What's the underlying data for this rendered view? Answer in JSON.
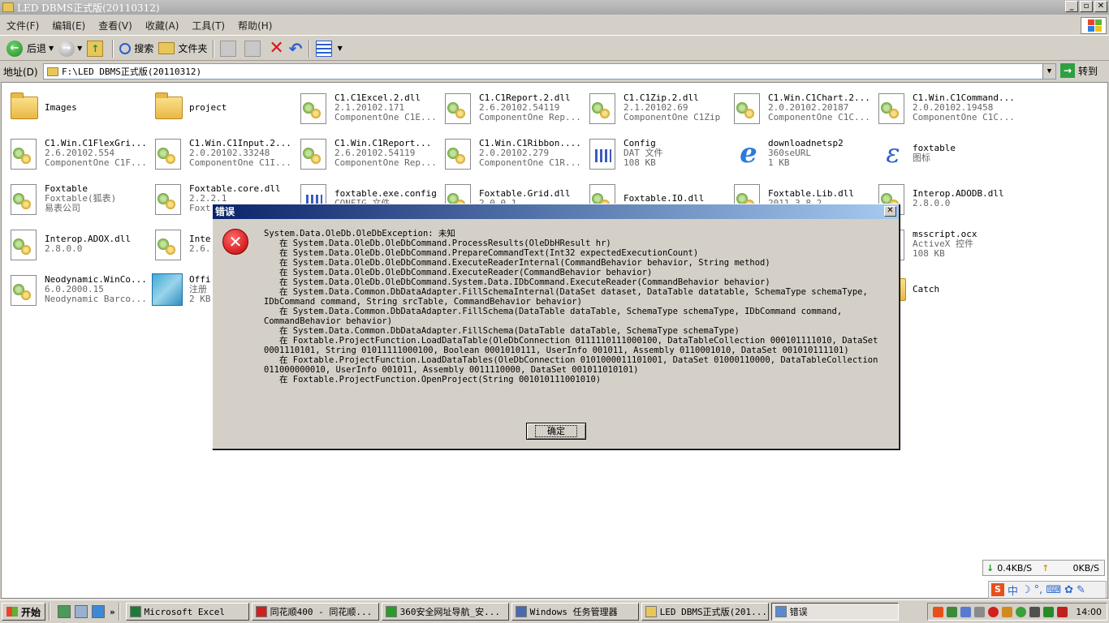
{
  "window": {
    "title": "LED DBMS正式版(20110312)"
  },
  "menu": [
    "文件(F)",
    "编辑(E)",
    "查看(V)",
    "收藏(A)",
    "工具(T)",
    "帮助(H)"
  ],
  "toolbar": {
    "back": "后退",
    "search": "搜索",
    "folders": "文件夹"
  },
  "address": {
    "label": "地址(D)",
    "value": "F:\\LED DBMS正式版(20110312)",
    "go": "转到"
  },
  "files": [
    {
      "name": "Images",
      "line2": "",
      "line3": "",
      "icon": "folder-icon"
    },
    {
      "name": "project",
      "line2": "",
      "line3": "",
      "icon": "folder-icon"
    },
    {
      "name": "C1.C1Excel.2.dll",
      "line2": "2.1.20102.171",
      "line3": "ComponentOne C1E...",
      "icon": "dll-icon"
    },
    {
      "name": "C1.C1Report.2.dll",
      "line2": "2.6.20102.54119",
      "line3": "ComponentOne Rep...",
      "icon": "dll-icon"
    },
    {
      "name": "C1.C1Zip.2.dll",
      "line2": "2.1.20102.69",
      "line3": "ComponentOne C1Zip",
      "icon": "dll-icon"
    },
    {
      "name": "C1.Win.C1Chart.2...",
      "line2": "2.0.20102.20187",
      "line3": "ComponentOne C1C...",
      "icon": "dll-icon"
    },
    {
      "name": "C1.Win.C1Command...",
      "line2": "2.0.20102.19458",
      "line3": "ComponentOne C1C...",
      "icon": "dll-icon"
    },
    {
      "name": "C1.Win.C1FlexGri...",
      "line2": "2.6.20102.554",
      "line3": "ComponentOne C1F...",
      "icon": "dll-icon"
    },
    {
      "name": "C1.Win.C1Input.2...",
      "line2": "2.0.20102.33248",
      "line3": "ComponentOne C1I...",
      "icon": "dll-icon"
    },
    {
      "name": "C1.Win.C1Report...",
      "line2": "2.6.20102.54119",
      "line3": "ComponentOne Rep...",
      "icon": "dll-icon"
    },
    {
      "name": "C1.Win.C1Ribbon....",
      "line2": "2.0.20102.279",
      "line3": "ComponentOne C1R...",
      "icon": "dll-icon"
    },
    {
      "name": "Config",
      "line2": "DAT 文件",
      "line3": "108 KB",
      "icon": "config-file-icon"
    },
    {
      "name": "downloadnetsp2",
      "line2": "360seURL",
      "line3": "1 KB",
      "icon": "ie-icon"
    },
    {
      "name": "foxtable",
      "line2": "图标",
      "line3": "",
      "icon": "foxtable-icon"
    },
    {
      "name": "Foxtable",
      "line2": "Foxtable(狐表)",
      "line3": "易表公司",
      "icon": "dll-icon"
    },
    {
      "name": "Foxtable.core.dll",
      "line2": "2.2.2.1",
      "line3": "Foxt",
      "icon": "dll-icon"
    },
    {
      "name": "foxtable.exe.config",
      "line2": "CONFIG 文件",
      "line3": "",
      "icon": "config-file-icon"
    },
    {
      "name": "Foxtable.Grid.dll",
      "line2": "2.0.0.1",
      "line3": "",
      "icon": "dll-icon"
    },
    {
      "name": "Foxtable.IO.dll",
      "line2": "",
      "line3": "",
      "icon": "dll-icon"
    },
    {
      "name": "Foxtable.Lib.dll",
      "line2": "2011.3.8.2",
      "line3": "",
      "icon": "dll-icon"
    },
    {
      "name": "Interop.ADODB.dll",
      "line2": "2.8.0.0",
      "line3": "",
      "icon": "dll-icon"
    },
    {
      "name": "Interop.ADOX.dll",
      "line2": "2.8.0.0",
      "line3": "",
      "icon": "dll-icon"
    },
    {
      "name": "Inte",
      "line2": "2.6.",
      "line3": "",
      "icon": "dll-icon"
    },
    {
      "name": "msscript.ocx",
      "line2": "ActiveX 控件",
      "line3": "108 KB",
      "icon": "dll-icon"
    },
    {
      "name": "Neodynamic.WinCo...",
      "line2": "6.0.2000.15",
      "line3": "Neodynamic Barco...",
      "icon": "dll-icon"
    },
    {
      "name": "Offi",
      "line2": "注册",
      "line3": "2 KB",
      "icon": "registry-icon"
    },
    {
      "name": "Catch",
      "line2": "",
      "line3": "",
      "icon": "folder-icon"
    }
  ],
  "dialog": {
    "title": "错误",
    "close": "✕",
    "message": "System.Data.OleDb.OleDbException: 未知\n   在 System.Data.OleDb.OleDbCommand.ProcessResults(OleDbHResult hr)\n   在 System.Data.OleDb.OleDbCommand.PrepareCommandText(Int32 expectedExecutionCount)\n   在 System.Data.OleDb.OleDbCommand.ExecuteReaderInternal(CommandBehavior behavior, String method)\n   在 System.Data.OleDb.OleDbCommand.ExecuteReader(CommandBehavior behavior)\n   在 System.Data.OleDb.OleDbCommand.System.Data.IDbCommand.ExecuteReader(CommandBehavior behavior)\n   在 System.Data.Common.DbDataAdapter.FillSchemaInternal(DataSet dataset, DataTable datatable, SchemaType schemaType, IDbCommand command, String srcTable, CommandBehavior behavior)\n   在 System.Data.Common.DbDataAdapter.FillSchema(DataTable dataTable, SchemaType schemaType, IDbCommand command, CommandBehavior behavior)\n   在 System.Data.Common.DbDataAdapter.FillSchema(DataTable dataTable, SchemaType schemaType)\n   在 Foxtable.ProjectFunction.LoadDataTable(OleDbConnection 0111110111000100, DataTableCollection 000101111010, DataSet 0001110101, String 01011111000100, Boolean 0001010111, UserInfo 001011, Assembly 0110001010, DataSet 001010111101)\n   在 Foxtable.ProjectFunction.LoadDataTables(OleDbConnection 0101000011101001, DataSet 01000110000, DataTableCollection 011000000010, UserInfo 001011, Assembly 0011110000, DataSet 001011010101)\n   在 Foxtable.ProjectFunction.OpenProject(String 001010111001010)",
    "ok": "确定"
  },
  "netspeed": {
    "down": "0.4KB/S",
    "up": "0KB/S"
  },
  "ime": {
    "lang": "中"
  },
  "taskbar": {
    "start": "开始",
    "more": "»",
    "tasks": [
      {
        "label": "Microsoft Excel",
        "color": "#1d7a3a"
      },
      {
        "label": "同花顺400 - 同花顺...",
        "color": "#cc2222"
      },
      {
        "label": "360安全网址导航_安...",
        "color": "#2a9a2a"
      },
      {
        "label": "Windows 任务管理器",
        "color": "#4a6ab0"
      },
      {
        "label": "LED DBMS正式版(201...",
        "color": "#e8c75a"
      },
      {
        "label": "错误",
        "color": "#5a8ad0"
      }
    ],
    "clock": "14:00"
  }
}
